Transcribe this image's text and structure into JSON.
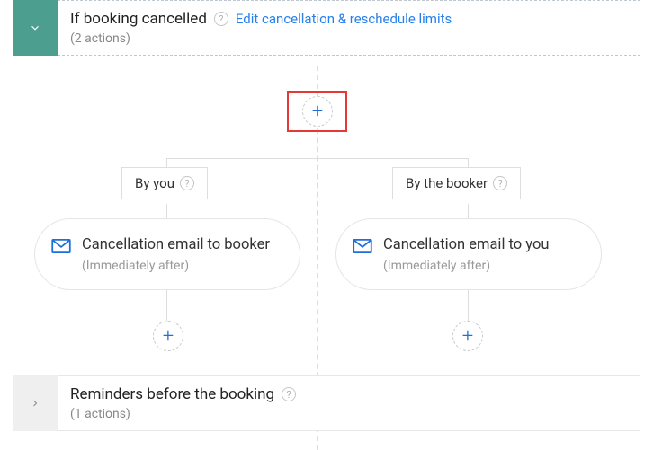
{
  "cancelled": {
    "title": "If booking cancelled",
    "sub": "(2 actions)",
    "edit": "Edit cancellation & reschedule limits"
  },
  "branches": {
    "left": {
      "label": "By you",
      "card_title": "Cancellation email to booker",
      "card_sub": "(Immediately after)"
    },
    "right": {
      "label": "By the booker",
      "card_title": "Cancellation email to you",
      "card_sub": "(Immediately after)"
    }
  },
  "reminders": {
    "title": "Reminders before the booking",
    "sub": "(1 actions)"
  },
  "colors": {
    "accent_teal": "#4c9f8e",
    "link_blue": "#2680eb",
    "plus_blue": "#1e6fd9",
    "highlight_red": "#e53935"
  }
}
